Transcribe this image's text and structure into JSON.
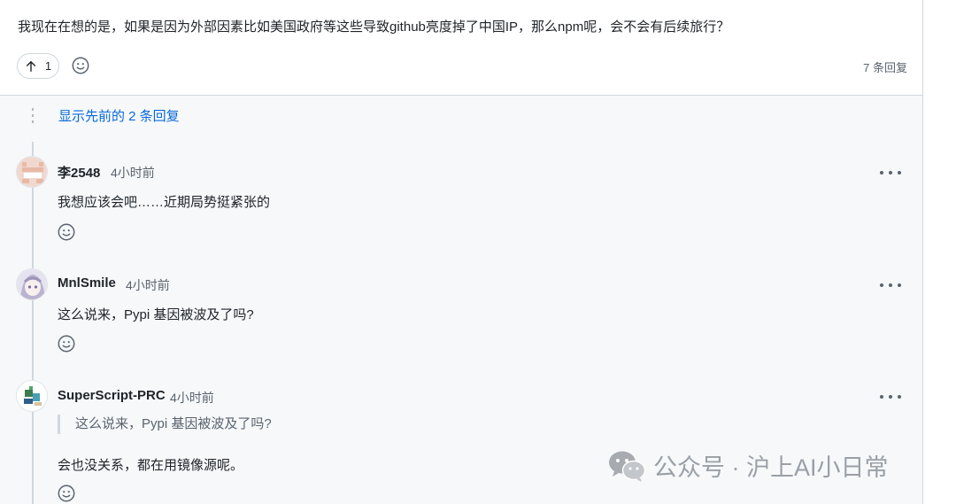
{
  "post": {
    "text": "我现在在想的是，如果是因为外部因素比如美国政府等这些导致github亮度掉了中国IP，那么npm呢，会不会有后续旅行？",
    "upvote_count": "1",
    "reply_count": "7 条回复"
  },
  "replies": {
    "show_previous": "显示先前的 2 条回复",
    "items": [
      {
        "author": "李2548",
        "time": "4小时前",
        "body": "我想应该会吧……近期局势挺紧张的"
      },
      {
        "author": "MnlSmile",
        "time": "4小时前",
        "body": "这么说来，Pypi 基因被波及了吗?"
      },
      {
        "author": "SuperScript-PRC",
        "time": "4小时前",
        "quote": "这么说来，Pypi 基因被波及了吗?",
        "body": "会也没关系，都在用镜像源呢。"
      }
    ]
  },
  "watermark": {
    "text": "公众号 · 沪上AI小日常"
  },
  "icons": {
    "upvote": "arrow-up-icon",
    "reaction": "smiley-icon",
    "more": "kebab-horizontal-icon",
    "watermark": "wechat-icon"
  },
  "colors": {
    "link": "#0969da",
    "muted": "#59636e",
    "border": "#d0d7de",
    "replies_bg": "#f6f8fa"
  }
}
